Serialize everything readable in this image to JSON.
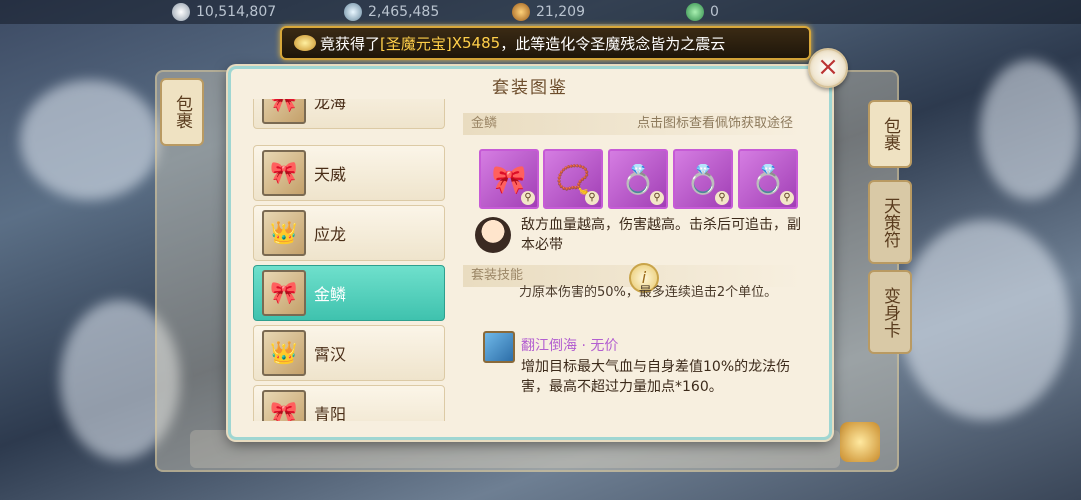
{
  "resources": [
    {
      "icon": "silver-coin-icon",
      "value": "10,514,807"
    },
    {
      "icon": "jade-icon",
      "value": "2,465,485"
    },
    {
      "icon": "copper-coin-icon",
      "value": "21,209"
    },
    {
      "icon": "gem-icon",
      "value": "0"
    }
  ],
  "announcement": {
    "prefix": "竟获得了",
    "item": "[圣魔元宝]",
    "qty": "X5485",
    "suffix": "，此等造化令圣魔残念皆为之震云"
  },
  "side_tabs": {
    "left_bag": "包裹",
    "right_bag": "包裹",
    "tiance": "天策符",
    "bianshen": "变身卡"
  },
  "dialog": {
    "title": "套装图鉴",
    "close_label": "×",
    "sets": [
      {
        "name": "龙海",
        "icon": "dragon-helmet-icon"
      },
      {
        "name": "天威",
        "icon": "heaven-helmet-icon"
      },
      {
        "name": "应龙",
        "icon": "yinglong-helmet-icon"
      },
      {
        "name": "金鳞",
        "icon": "golden-scale-helmet-icon",
        "selected": true
      },
      {
        "name": "霄汉",
        "icon": "xiaohan-helmet-icon"
      },
      {
        "name": "青阳",
        "icon": "qingyang-helmet-icon"
      }
    ],
    "selected_set": {
      "header": "金鳞",
      "hint": "点击图标查看佩饰获取途径",
      "pieces": [
        {
          "icon": "bow-ornament-icon"
        },
        {
          "icon": "necklace-icon"
        },
        {
          "icon": "bracelet-icon"
        },
        {
          "icon": "ring-icon"
        },
        {
          "icon": "ring-alt-icon"
        }
      ],
      "description": "敌方血量越高，伤害越高。击杀后可追击，副本必带",
      "skills_header": "套装技能",
      "partial_text": "力原本伤害的50%，最多连续追击2个单位。",
      "skill": {
        "name": "翻江倒海 · 无价",
        "desc": "增加目标最大气血与自身差值10%的龙法伤害，最高不超过力量加点*160。"
      }
    }
  },
  "colors": {
    "dialog_bg": "#f7efdf",
    "selected_item": "#3fc2ae",
    "epic_purple": "#c65bd6",
    "announce_gold": "#ffcf4a"
  }
}
